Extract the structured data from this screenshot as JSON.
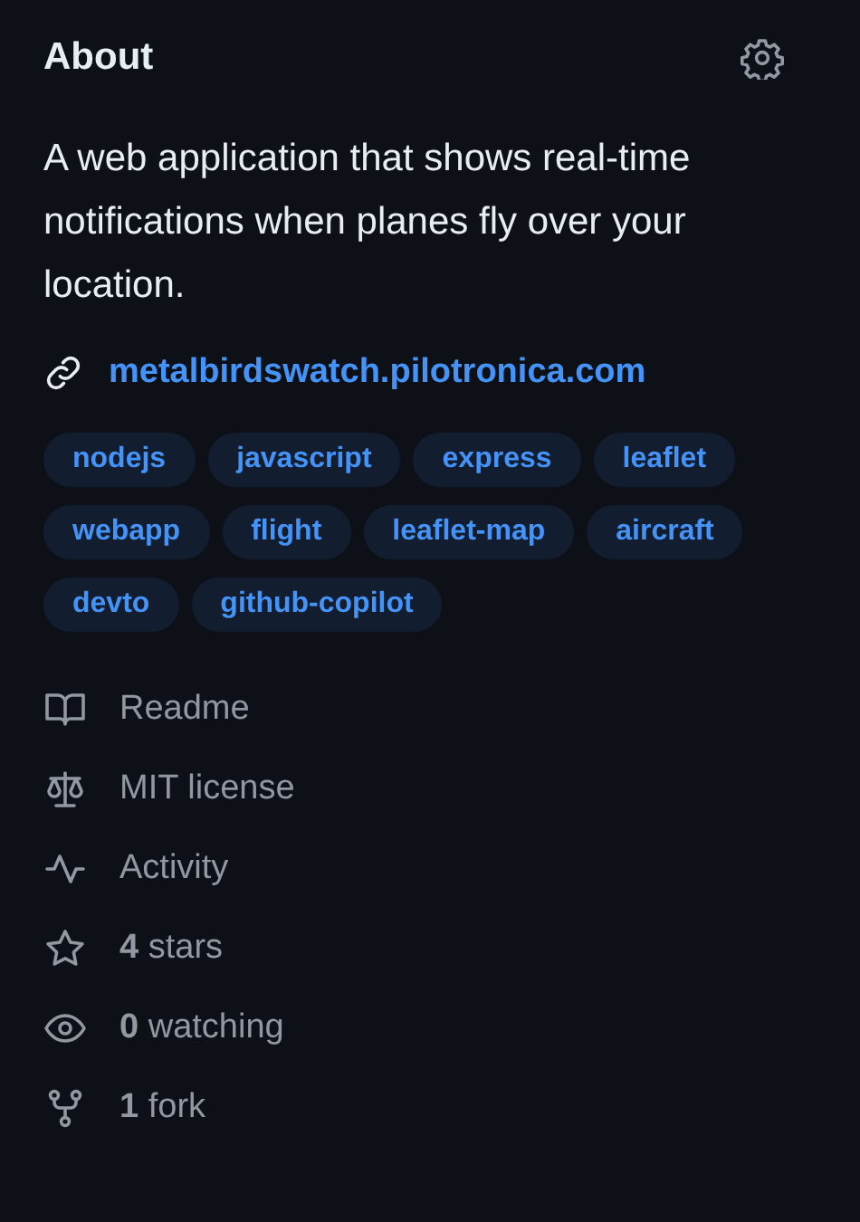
{
  "title": "About",
  "description": "A web application that shows real-time notifications when planes fly over your location.",
  "link": "metalbirdswatch.pilotronica.com",
  "topics": [
    "nodejs",
    "javascript",
    "express",
    "leaflet",
    "webapp",
    "flight",
    "leaflet-map",
    "aircraft",
    "devto",
    "github-copilot"
  ],
  "stats": [
    {
      "kind": "readme",
      "text": "Readme"
    },
    {
      "kind": "license",
      "text": "MIT license"
    },
    {
      "kind": "activity",
      "text": "Activity"
    },
    {
      "kind": "stars",
      "text": "**4** stars"
    },
    {
      "kind": "watching",
      "text": "**0** watching"
    },
    {
      "kind": "fork",
      "text": "**1** fork"
    }
  ]
}
